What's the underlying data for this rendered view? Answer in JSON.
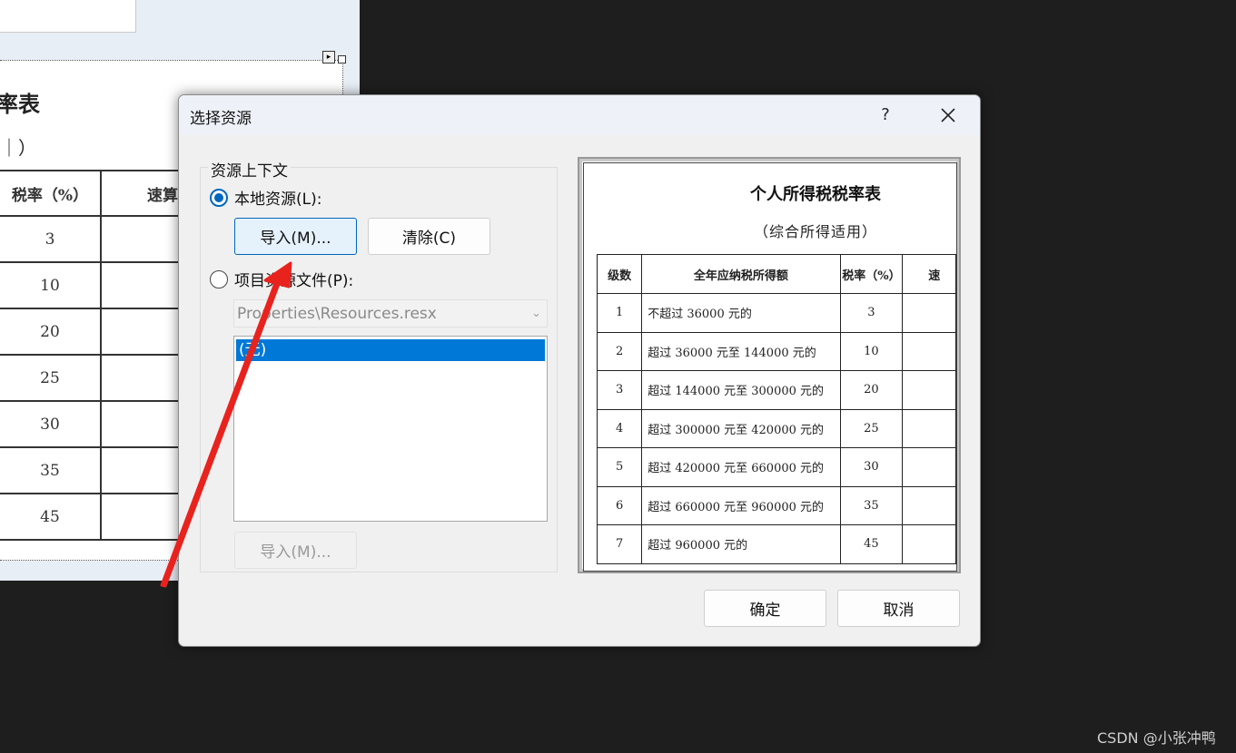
{
  "background": {
    "doc_title_fragment": "率表",
    "doc_subtitle_fragment": "｜）",
    "header_rate": "税率（%）",
    "header_quick": "速算",
    "rates": [
      "3",
      "10",
      "20",
      "25",
      "30",
      "35",
      "45"
    ]
  },
  "dialog": {
    "title": "选择资源",
    "help_label": "?",
    "group_label": "资源上下文",
    "local_radio_label": "本地资源(L):",
    "import_button": "导入(M)...",
    "clear_button": "清除(C)",
    "project_radio_label": "项目资源文件(P):",
    "project_file_value": "Properties\\Resources.resx",
    "list_items": [
      "(无)"
    ],
    "import_button_2": "导入(M)...",
    "ok_button": "确定",
    "cancel_button": "取消"
  },
  "preview": {
    "title": "个人所得税税率表",
    "subtitle": "（综合所得适用）",
    "headers": [
      "级数",
      "全年应纳税所得额",
      "税率（%）",
      "速"
    ],
    "rows": [
      [
        "1",
        "不超过 36000 元的",
        "3"
      ],
      [
        "2",
        "超过 36000 元至 144000 元的",
        "10"
      ],
      [
        "3",
        "超过 144000 元至 300000 元的",
        "20"
      ],
      [
        "4",
        "超过 300000 元至 420000 元的",
        "25"
      ],
      [
        "5",
        "超过 420000 元至 660000 元的",
        "30"
      ],
      [
        "6",
        "超过 660000 元至 960000 元的",
        "35"
      ],
      [
        "7",
        "超过 960000 元的",
        "45"
      ]
    ]
  },
  "watermark": "CSDN @小张冲鸭",
  "colors": {
    "accent": "#0067c0",
    "selection": "#0078d7",
    "annotation_arrow": "#e8231e",
    "page_background": "#1e1e1e"
  }
}
